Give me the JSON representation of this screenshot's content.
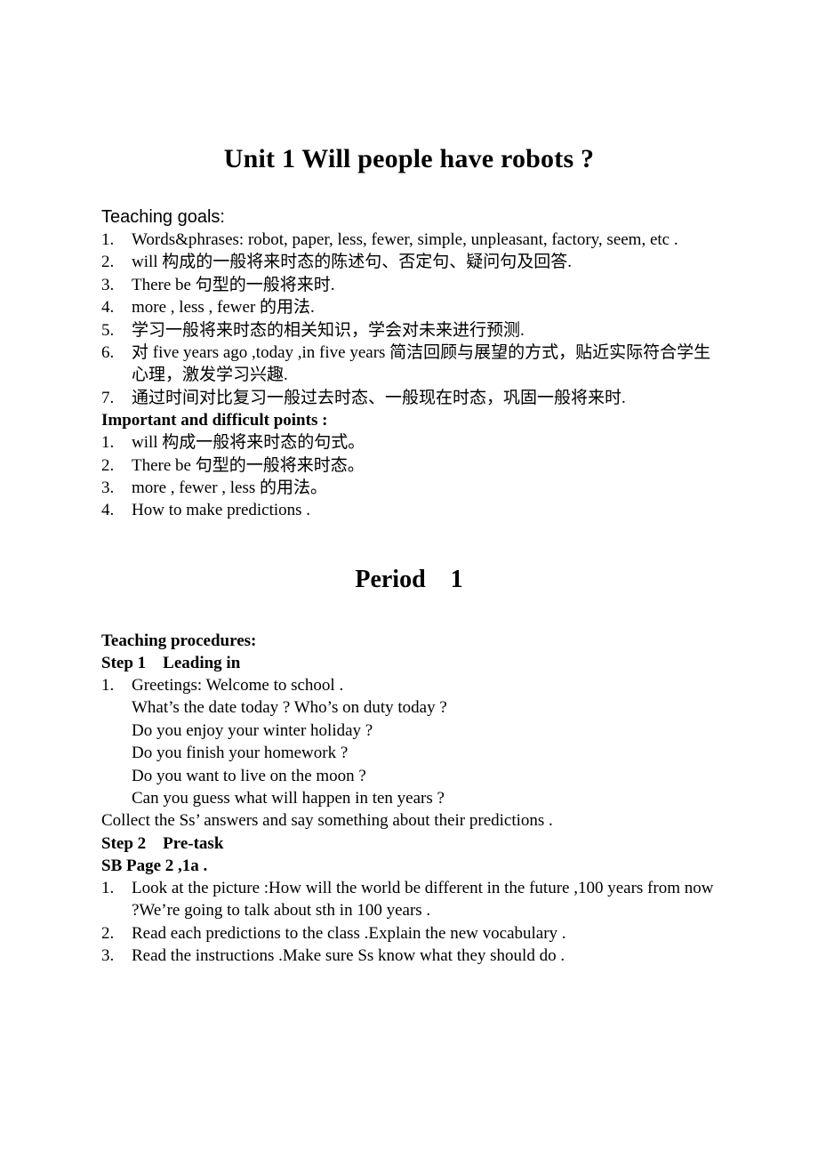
{
  "document": {
    "title": "Unit 1 Will people have robots ?",
    "period_heading": "Period    1"
  },
  "teaching_goals": {
    "heading": "Teaching goals:",
    "items": [
      "Words&phrases:  robot,  paper,  less,  fewer,  simple,  unpleasant,  factory, seem, etc .",
      "will  构成的一般将来时态的陈述句、否定句、疑问句及回答.",
      "There be  句型的一般将来时.",
      "more , less , fewer  的用法.",
      "学习一般将来时态的相关知识，学会对未来进行预测.",
      "对 five years ago ,today ,in five years  简洁回顾与展望的方式，贴近实际符合学生心理，激发学习兴趣.",
      "通过时间对比复习一般过去时态、一般现在时态，巩固一般将来时."
    ]
  },
  "important_points": {
    "heading": "Important and difficult points :",
    "items": [
      "will 构成一般将来时态的句式。",
      "There be  句型的一般将来时态。",
      "more , fewer , less  的用法。",
      "How to make predictions ."
    ]
  },
  "teaching_procedures": {
    "heading": "Teaching procedures:",
    "step1": {
      "label": "Step 1    Leading in",
      "item1_main": "Greetings: Welcome to school .",
      "item1_sublines": [
        "What’s the date today ? Who’s on duty today ?",
        "Do you enjoy your winter holiday ?",
        "Do you finish your homework ?",
        "Do you want to live on the moon ?",
        "Can you guess what will happen in ten years ?"
      ],
      "collect_line": "Collect the Ss’ answers and say something about their predictions ."
    },
    "step2": {
      "label": "Step 2    Pre-task",
      "sb_page": "SB Page 2 ,1a .",
      "items": [
        "Look at the picture :How will the world be different in the future ,100 years from now ?We’re going to talk about sth in 100 years .",
        "Read each predictions to the class .Explain the new vocabulary .",
        "Read the instructions .Make sure Ss know what they should do ."
      ]
    }
  },
  "list_markers": {
    "n1": "1.",
    "n2": "2.",
    "n3": "3.",
    "n4": "4.",
    "n5": "5.",
    "n6": "6.",
    "n7": "7."
  },
  "colors": {
    "page_background": "#ffffff",
    "text": "#000000"
  }
}
